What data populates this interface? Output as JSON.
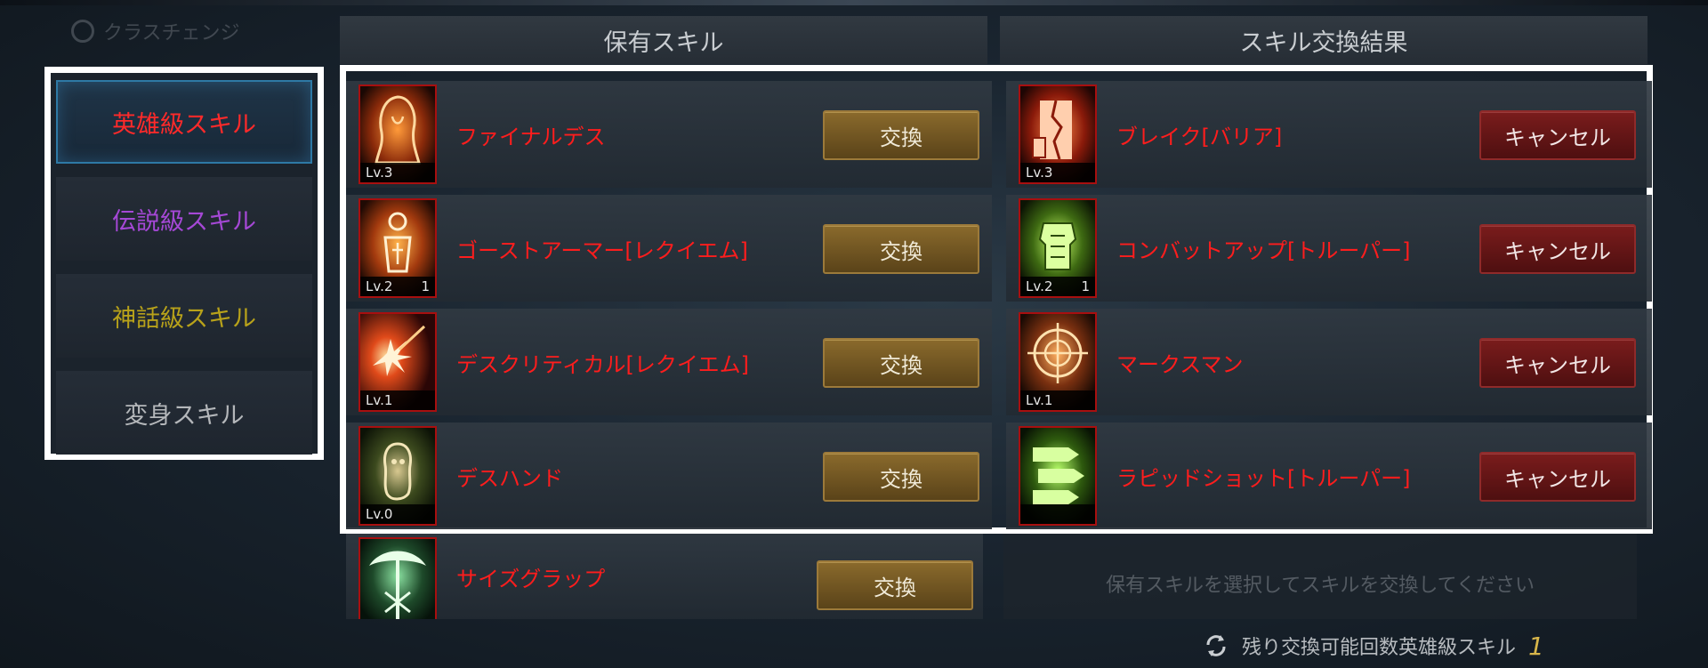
{
  "header": {
    "class_change": "クラスチェンジ",
    "owned_title": "保有スキル",
    "result_title": "スキル交換結果"
  },
  "tabs": [
    {
      "label": "英雄級スキル",
      "color": "#ff2a2a",
      "active": true
    },
    {
      "label": "伝説級スキル",
      "color": "#a548d6"
    },
    {
      "label": "神話級スキル",
      "color": "#b8a21a"
    },
    {
      "label": "変身スキル",
      "color": "#b4b7ba"
    }
  ],
  "owned_skills": [
    {
      "name": "ファイナルデス",
      "level": "Lv.3",
      "count": "",
      "icon": "hooded-reaper-icon",
      "button": "交換"
    },
    {
      "name": "ゴーストアーマー[レクイエム]",
      "level": "Lv.2",
      "count": "1",
      "icon": "ghost-armor-icon",
      "button": "交換"
    },
    {
      "name": "デスクリティカル[レクイエム]",
      "level": "Lv.1",
      "count": "",
      "icon": "death-critical-icon",
      "button": "交換"
    },
    {
      "name": "デスハンド",
      "level": "Lv.0",
      "count": "",
      "icon": "death-hand-icon",
      "button": "交換"
    },
    {
      "name": "サイズグラップ",
      "level": "",
      "count": "",
      "icon": "scythe-grab-icon",
      "button": "交換"
    }
  ],
  "result_skills": [
    {
      "name": "ブレイク[バリア]",
      "level": "Lv.3",
      "count": "",
      "icon": "break-barrier-icon",
      "button": "キャンセル"
    },
    {
      "name": "コンバットアップ[トルーパー]",
      "level": "Lv.2",
      "count": "1",
      "icon": "combat-up-icon",
      "button": "キャンセル"
    },
    {
      "name": "マークスマン",
      "level": "Lv.1",
      "count": "",
      "icon": "marksman-icon",
      "button": "キャンセル"
    },
    {
      "name": "ラピッドショット[トルーパー]",
      "level": "",
      "count": "",
      "icon": "rapid-shot-icon",
      "button": "キャンセル"
    }
  ],
  "hint": "保有スキルを選択してスキルを交換してください",
  "footer": {
    "remaining_label": "残り交換可能回数英雄級スキル",
    "remaining_count": "1"
  },
  "colors": {
    "skill_name": "#ff1d1d",
    "swap_button": "#8a6a2c",
    "cancel_button": "#7a1c1c",
    "frame_highlight": "#ffffff"
  }
}
